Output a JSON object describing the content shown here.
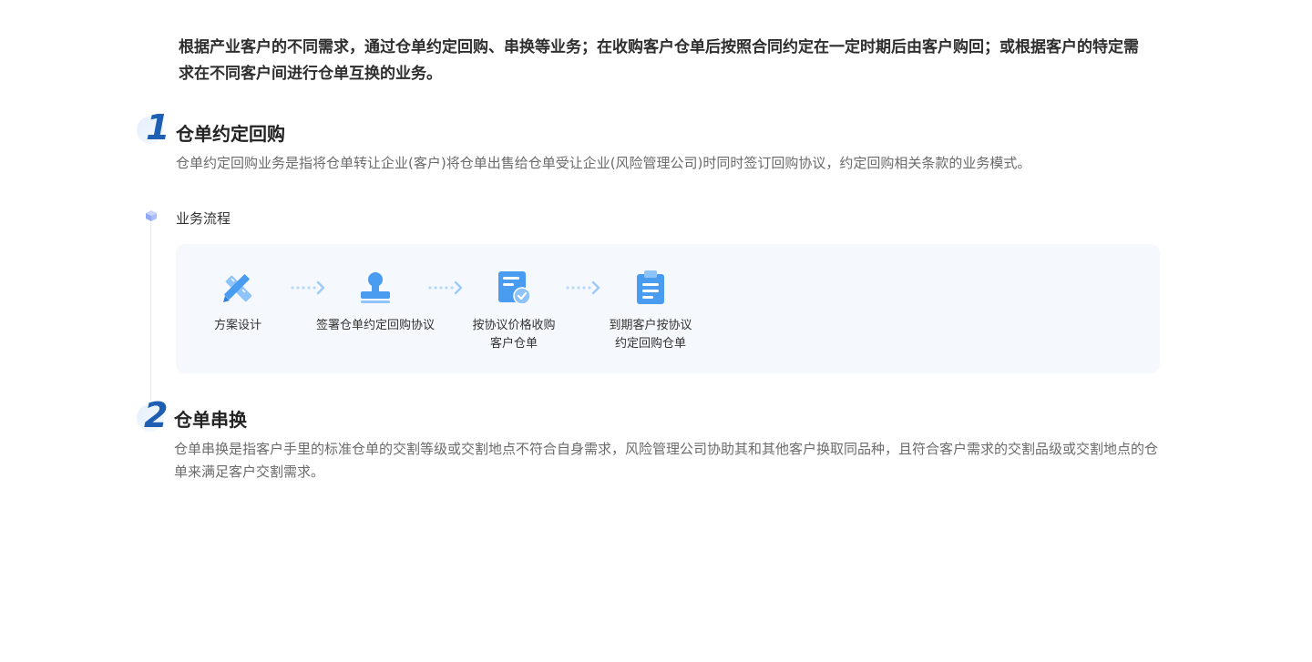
{
  "intro": "根据产业客户的不同需求，通过仓单约定回购、串换等业务；在收购客户仓单后按照合同约定在一定时期后由客户购回；或根据客户的特定需求在不同客户间进行仓单互换的业务。",
  "sections": [
    {
      "number": "1",
      "title": "仓单约定回购",
      "desc": "仓单约定回购业务是指将仓单转让企业(客户)将仓单出售给仓单受让企业(风险管理公司)时同时签订回购协议，约定回购相关条款的业务模式。"
    },
    {
      "number": "2",
      "title": "仓单串换",
      "desc": "仓单串换是指客户手里的标准仓单的交割等级或交割地点不符合自身需求，风险管理公司协助其和其他客户换取同品种，且符合客户需求的交割品级或交割地点的仓单来满足客户交割需求。"
    }
  ],
  "flow": {
    "label": "业务流程",
    "steps": [
      {
        "icon": "pencil-ruler-icon",
        "line1": "方案设计",
        "line2": ""
      },
      {
        "icon": "stamp-icon",
        "line1": "签署仓单约定回购协议",
        "line2": ""
      },
      {
        "icon": "document-check-icon",
        "line1": "按协议价格收购",
        "line2": "客户仓单"
      },
      {
        "icon": "clipboard-icon",
        "line1": "到期客户按协议",
        "line2": "约定回购仓单"
      }
    ]
  },
  "colors": {
    "accent": "#1e5fb3",
    "icon_blue": "#4a9cf0",
    "icon_light": "#8ec4fa",
    "box_bg": "#f5f8fc"
  }
}
